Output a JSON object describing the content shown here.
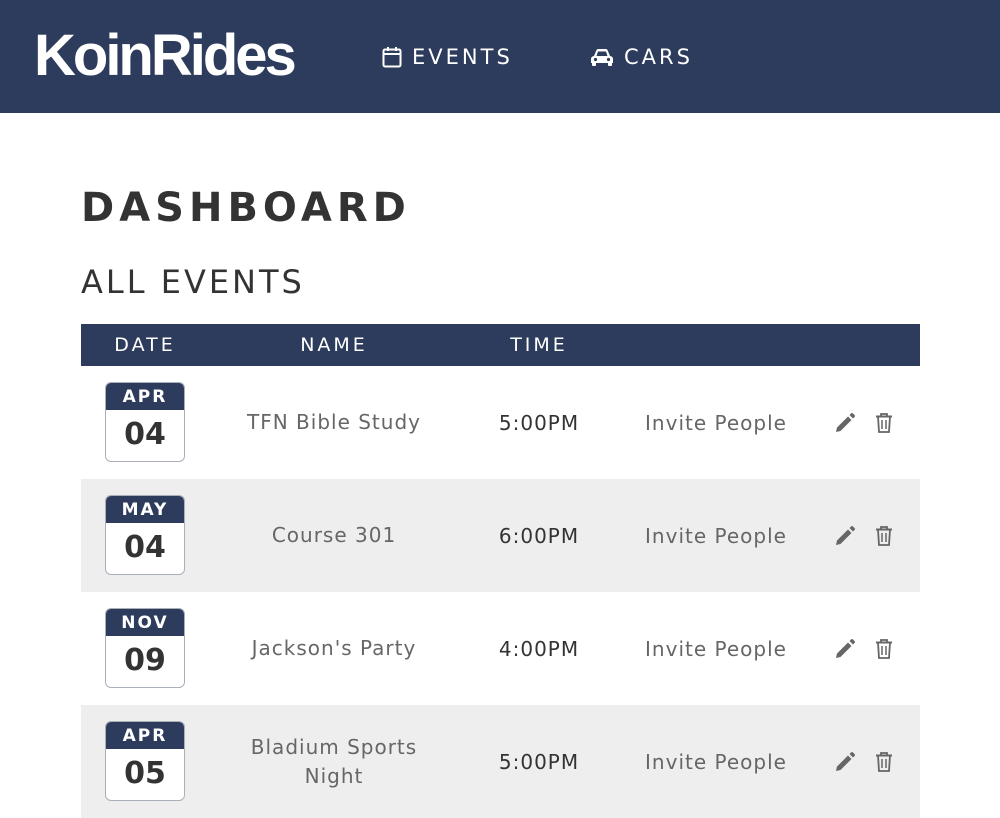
{
  "app": {
    "logo": "KoinRides"
  },
  "nav": {
    "events_label": "EVENTS",
    "events_icon": "calendar-icon",
    "cars_label": "CARS",
    "cars_icon": "car-icon"
  },
  "page": {
    "title": "DASHBOARD",
    "section_title": "ALL EVENTS"
  },
  "table": {
    "headers": {
      "date": "DATE",
      "name": "NAME",
      "time": "TIME"
    },
    "rows": [
      {
        "month": "APR",
        "day": "04",
        "name": "TFN Bible Study",
        "time": "5:00PM",
        "invite": "Invite People"
      },
      {
        "month": "MAY",
        "day": "04",
        "name": "Course 301",
        "time": "6:00PM",
        "invite": "Invite People"
      },
      {
        "month": "NOV",
        "day": "09",
        "name": "Jackson's Party",
        "time": "4:00PM",
        "invite": "Invite People"
      },
      {
        "month": "APR",
        "day": "05",
        "name": "Bladium Sports Night",
        "time": "5:00PM",
        "invite": "Invite People"
      }
    ],
    "row_icons": [
      "pencil-icon",
      "trash-icon"
    ]
  },
  "colors": {
    "navy": "#2d3c5c",
    "alt_row": "#eeeeee",
    "text_dark": "#333333",
    "text_muted": "#666666"
  }
}
